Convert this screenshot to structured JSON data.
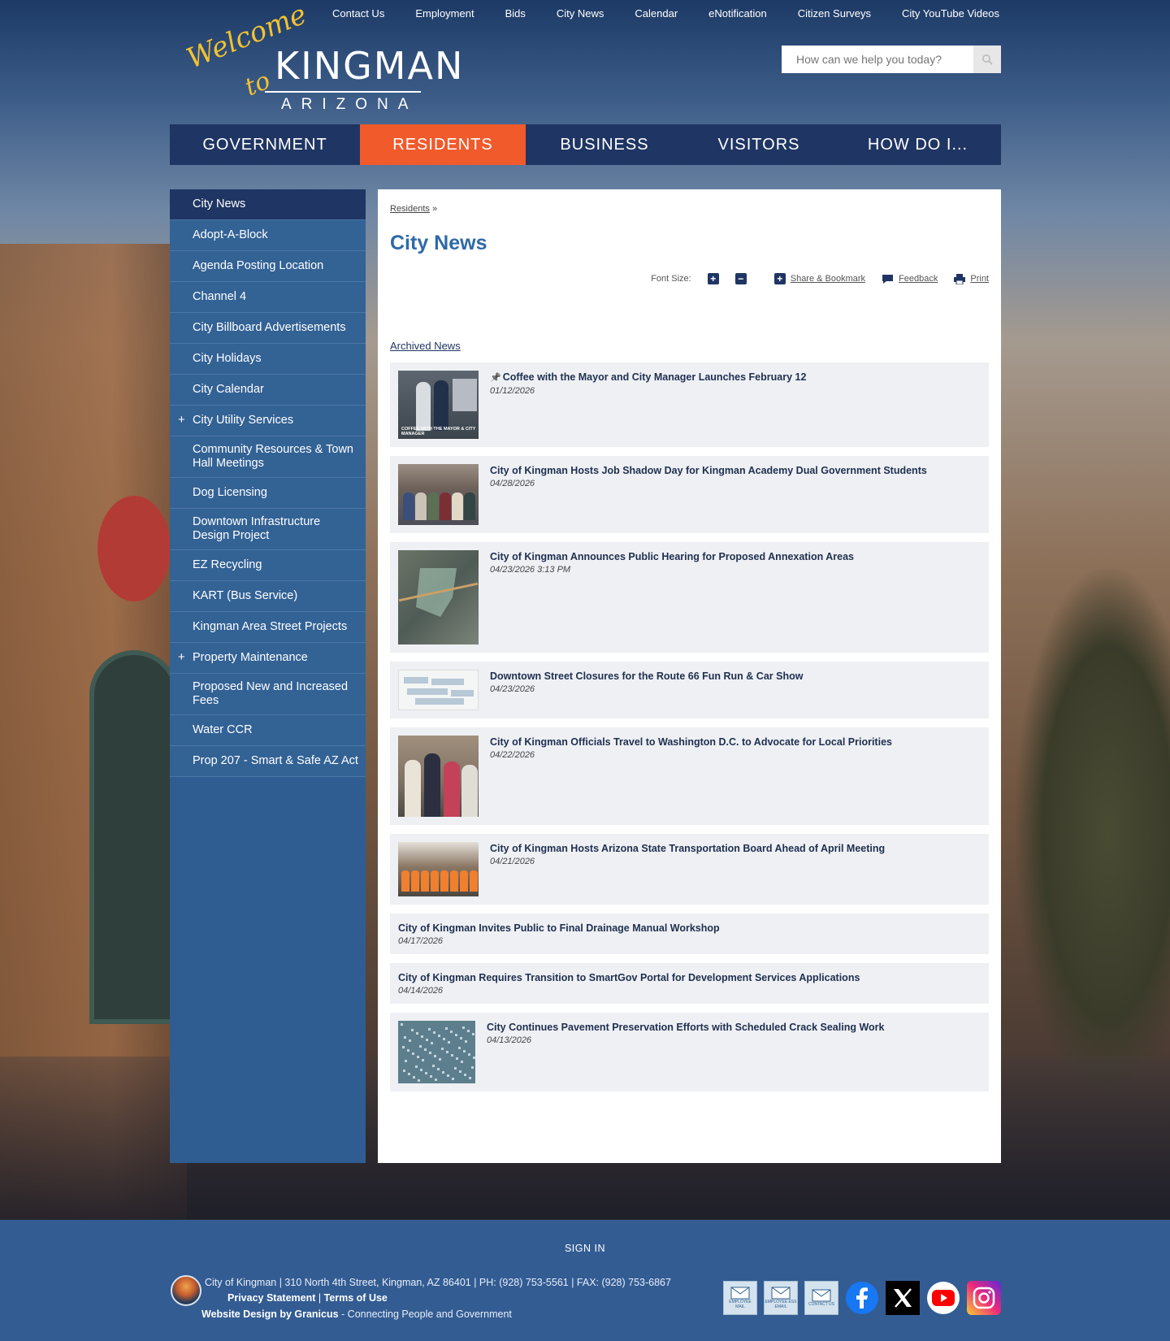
{
  "utility_nav": [
    "Contact Us",
    "Employment",
    "Bids",
    "City News",
    "Calendar",
    "eNotification",
    "Citizen Surveys",
    "City YouTube Videos"
  ],
  "logo": {
    "script1": "Welcome",
    "script2": "to",
    "name": "KINGMAN",
    "state": "ARIZONA"
  },
  "search": {
    "placeholder": "How can we help you today?"
  },
  "main_nav": [
    {
      "label": "GOVERNMENT",
      "active": false
    },
    {
      "label": "RESIDENTS",
      "active": true
    },
    {
      "label": "BUSINESS",
      "active": false
    },
    {
      "label": "VISITORS",
      "active": false
    },
    {
      "label": "HOW DO I...",
      "active": false
    }
  ],
  "sidebar": [
    {
      "label": "City News",
      "active": true,
      "expandable": false
    },
    {
      "label": "Adopt-A-Block",
      "expandable": false
    },
    {
      "label": "Agenda Posting Location",
      "expandable": false
    },
    {
      "label": "Channel 4",
      "expandable": false
    },
    {
      "label": "City Billboard Advertisements",
      "expandable": false
    },
    {
      "label": "City Holidays",
      "expandable": false
    },
    {
      "label": "City Calendar",
      "expandable": false
    },
    {
      "label": "City Utility Services",
      "expandable": true
    },
    {
      "label": "Community Resources & Town Hall Meetings",
      "expandable": false
    },
    {
      "label": "Dog Licensing",
      "expandable": false
    },
    {
      "label": "Downtown Infrastructure Design Project",
      "expandable": false
    },
    {
      "label": "EZ Recycling",
      "expandable": false
    },
    {
      "label": "KART (Bus Service)",
      "expandable": false
    },
    {
      "label": "Kingman Area Street Projects",
      "expandable": false
    },
    {
      "label": "Property Maintenance",
      "expandable": true
    },
    {
      "label": "Proposed New and Increased Fees",
      "expandable": false
    },
    {
      "label": "Water CCR",
      "expandable": false
    },
    {
      "label": "Prop 207 - Smart & Safe AZ Act",
      "expandable": false
    }
  ],
  "expand_symbol": "+",
  "breadcrumb": {
    "link": "Residents",
    "separator": "»"
  },
  "page_title": "City News",
  "tools": {
    "font_size_label": "Font Size:",
    "share": "Share & Bookmark",
    "feedback": "Feedback",
    "print": "Print"
  },
  "archived_label": "Archived News",
  "news": [
    {
      "title": "Coffee with the Mayor and City Manager Launches February 12",
      "date": "01/12/2026",
      "pinned": true,
      "thumb": "t1",
      "thumb_caption": "COFFEE WITH THE MAYOR & CITY MANAGER"
    },
    {
      "title": "City of Kingman Hosts Job Shadow Day for Kingman Academy Dual Government Students",
      "date": "04/28/2026",
      "thumb": "t2"
    },
    {
      "title": "City of Kingman Announces Public Hearing for Proposed Annexation Areas",
      "date": "04/23/2026 3:13 PM",
      "thumb": "t3"
    },
    {
      "title": "Downtown Street Closures for the Route 66 Fun Run & Car Show",
      "date": "04/23/2026",
      "thumb": "t4"
    },
    {
      "title": "City of Kingman Officials Travel to Washington D.C. to Advocate for Local Priorities",
      "date": "04/22/2026",
      "thumb": "t5"
    },
    {
      "title": "City of Kingman Hosts Arizona State Transportation Board Ahead of April Meeting",
      "date": "04/21/2026",
      "thumb": "t6"
    },
    {
      "title": "City of Kingman Invites Public to Final Drainage Manual Workshop",
      "date": "04/17/2026",
      "thumb": null
    },
    {
      "title": "City of Kingman Requires Transition to SmartGov Portal for Development Services Applications",
      "date": "04/14/2026",
      "thumb": null
    },
    {
      "title": "City Continues Pavement Preservation Efforts with Scheduled Crack Sealing Work",
      "date": "04/13/2026",
      "thumb": "t9"
    }
  ],
  "footer": {
    "signin": "SIGN IN",
    "address": "City of Kingman | 310 North 4th Street, Kingman, AZ 86401 | PH: (928) 753-5561 | FAX: (928) 753-6867",
    "privacy": "Privacy Statement",
    "link_separator": "|",
    "terms": "Terms of Use",
    "credit_bold": "Website Design by Granicus",
    "credit_rest": " - Connecting People and Government",
    "social": [
      {
        "name": "employee-mail",
        "label": "EMPLOYEE MAIL"
      },
      {
        "name": "employee-ess-email",
        "label": "EMPLOYEE ESS EMAIL"
      },
      {
        "name": "contact-us",
        "label": "CONTACT US"
      },
      {
        "name": "facebook"
      },
      {
        "name": "x"
      },
      {
        "name": "youtube"
      },
      {
        "name": "instagram"
      }
    ]
  },
  "colors": {
    "navy": "#1f3563",
    "accent": "#f15a2b",
    "sidebar": "#336295",
    "title": "#2e6aa8"
  }
}
